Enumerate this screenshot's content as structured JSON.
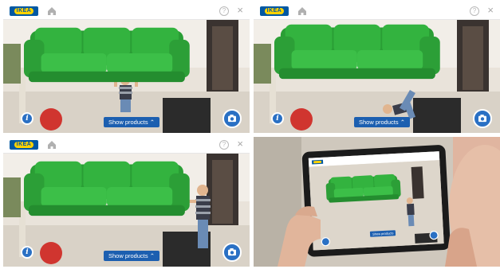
{
  "brand": {
    "logo_text": "IKEA"
  },
  "toolbar": {
    "help_label": "?",
    "close_label": "×"
  },
  "scene": {
    "show_products_label": "Show products ⌃",
    "info_label": "i"
  },
  "tablet": {
    "show_products_label": "Show products"
  },
  "colors": {
    "sofa": "#2fae3c",
    "ikea_blue": "#0058a3",
    "ikea_yellow": "#ffd200",
    "button_blue": "#1c5fb0"
  },
  "icons": [
    "home-icon",
    "help-icon",
    "close-icon",
    "info-icon",
    "camera-icon",
    "chevron-up-icon"
  ]
}
